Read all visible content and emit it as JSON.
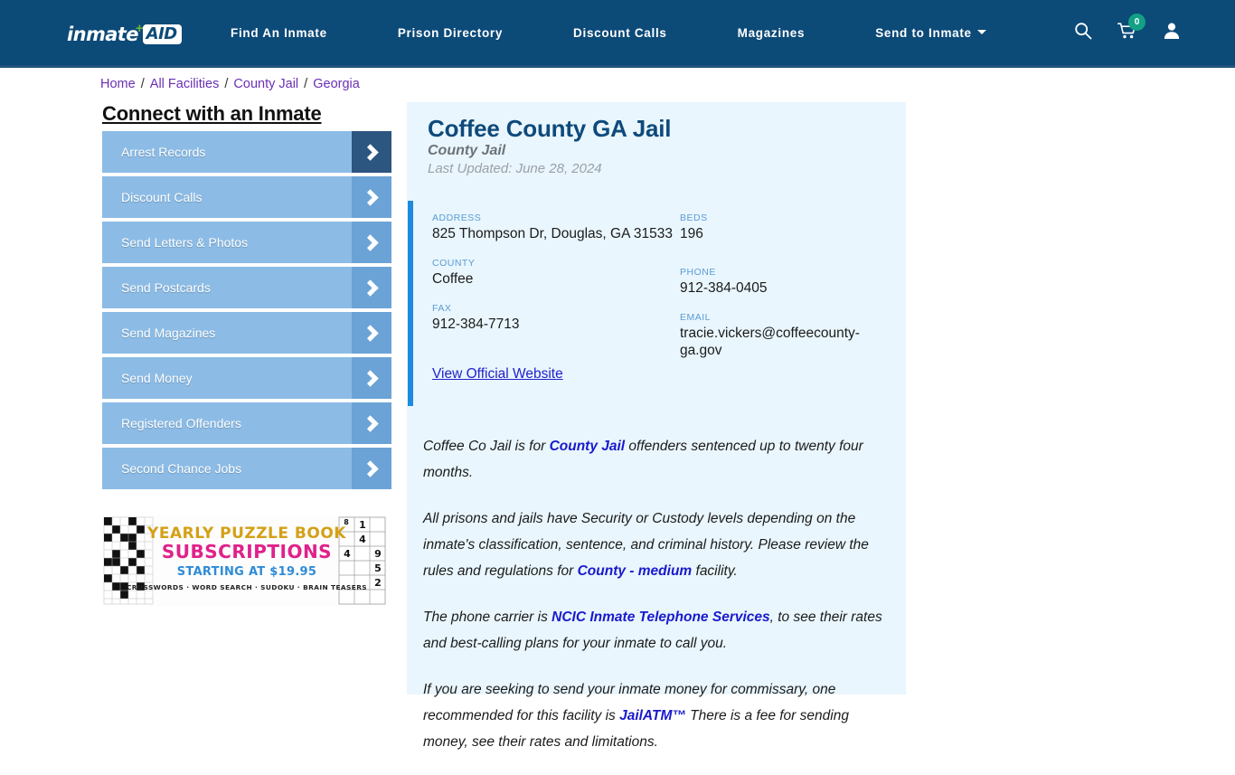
{
  "header": {
    "logo": {
      "word": "inmate",
      "plus": "+",
      "badge": "AID"
    },
    "nav_items": [
      {
        "label": "Find An Inmate",
        "has_dropdown": false
      },
      {
        "label": "Prison Directory",
        "has_dropdown": false
      },
      {
        "label": "Discount Calls",
        "has_dropdown": false
      },
      {
        "label": "Magazines",
        "has_dropdown": false
      },
      {
        "label": "Send to Inmate",
        "has_dropdown": true
      }
    ],
    "icons": {
      "search": "search-icon",
      "cart": "cart-icon",
      "cart_count": "0",
      "account": "user-account-icon"
    },
    "background_color": "#0c4a78",
    "cart_badge_color": "#13a085"
  },
  "breadcrumb": {
    "items": [
      "Home",
      "All Facilities",
      "County Jail",
      "Georgia"
    ],
    "separator": "/",
    "link_color": "#6a2fb5"
  },
  "sidebar": {
    "heading": "Connect with an Inmate",
    "items": [
      {
        "label": "Arrest Records",
        "active": true
      },
      {
        "label": "Discount Calls",
        "active": false
      },
      {
        "label": "Send Letters & Photos",
        "active": false
      },
      {
        "label": "Send Postcards",
        "active": false
      },
      {
        "label": "Send Magazines",
        "active": false
      },
      {
        "label": "Send Money",
        "active": false
      },
      {
        "label": "Registered Offenders",
        "active": false
      },
      {
        "label": "Second Chance Jobs",
        "active": false
      }
    ],
    "button_color": "#8cbce6",
    "arrow_color": "#6ba3d6",
    "arrow_active_color": "#2c5580"
  },
  "ad": {
    "line1": "YEARLY PUZZLE BOOK",
    "line2": "SUBSCRIPTIONS",
    "line3": "STARTING AT $19.95",
    "line4": "CROSSWORDS · WORD SEARCH · SUDOKU · BRAIN TEASERS",
    "sudoku_digits": [
      "1",
      "4",
      "4",
      "9",
      "5",
      "2"
    ]
  },
  "facility": {
    "title": "Coffee County GA Jail",
    "subtype": "County Jail",
    "last_updated": "Last Updated: June 28, 2024",
    "accent_color": "#1e8ae0",
    "panel_color": "#e9f6fd",
    "info_left": [
      {
        "label": "ADDRESS",
        "value": "825 Thompson Dr, Douglas, GA 31533"
      },
      {
        "label": "COUNTY",
        "value": "Coffee"
      },
      {
        "label": "FAX",
        "value": "912-384-7713"
      }
    ],
    "info_right": [
      {
        "label": "BEDS",
        "value": "196"
      },
      {
        "label": "PHONE",
        "value": "912-384-0405"
      },
      {
        "label": "EMAIL",
        "value": "tracie.vickers@coffeecounty-ga.gov"
      }
    ],
    "website_link": "View Official Website",
    "paragraphs": [
      [
        {
          "t": "Coffee Co Jail is for ",
          "b": false
        },
        {
          "t": "County Jail",
          "b": true
        },
        {
          "t": " offenders sentenced up to twenty four months.",
          "b": false
        }
      ],
      [
        {
          "t": "All prisons and jails have Security or Custody levels depending on the inmate's classification, sentence, and criminal history. Please review the rules and regulations for ",
          "b": false
        },
        {
          "t": "County - medium",
          "b": true
        },
        {
          "t": " facility.",
          "b": false
        }
      ],
      [
        {
          "t": "The phone carrier is ",
          "b": false
        },
        {
          "t": "NCIC Inmate Telephone Services",
          "b": true
        },
        {
          "t": ", to see their rates and best-calling plans for your inmate to call you.",
          "b": false
        }
      ],
      [
        {
          "t": "If you are seeking to send your inmate money for commissary, one recommended for this facility is ",
          "b": false
        },
        {
          "t": "JailATM™",
          "b": true
        },
        {
          "t": " There is a fee for sending money, see their rates and limitations.",
          "b": false
        }
      ]
    ]
  }
}
